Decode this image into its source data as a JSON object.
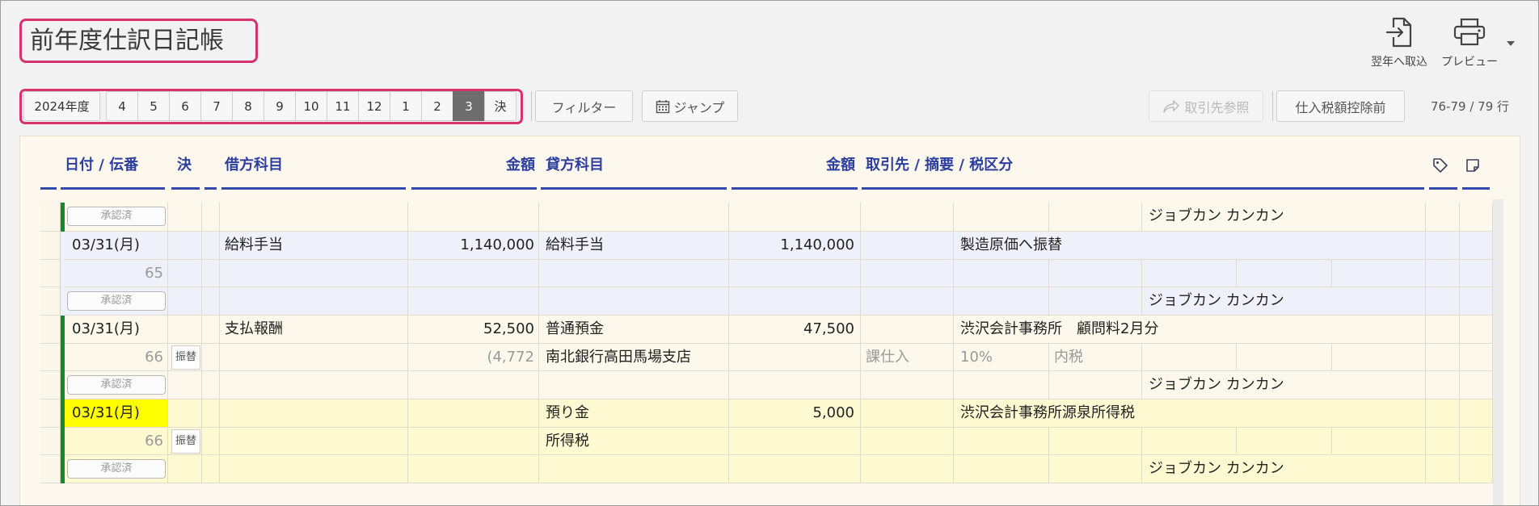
{
  "page": {
    "title": "前年度仕訳日記帳"
  },
  "actions": {
    "import_next_year": {
      "label": "翌年へ取込",
      "icon": "file-import-icon"
    },
    "preview": {
      "label": "プレビュー",
      "icon": "printer-icon",
      "menu_icon": "caret-down-icon"
    }
  },
  "period_bar": {
    "fiscal_year": "2024年度",
    "periods": [
      "4",
      "5",
      "6",
      "7",
      "8",
      "9",
      "10",
      "11",
      "12",
      "1",
      "2",
      "3",
      "決"
    ],
    "selected": "3"
  },
  "toolbar": {
    "filter": "フィルター",
    "jump": {
      "label": "ジャンプ",
      "icon": "calendar-icon"
    },
    "partner_reference": {
      "label": "取引先参照",
      "icon": "share-icon",
      "disabled": true
    },
    "tax_mode": "仕入税額控除前",
    "row_count": "76-79 / 79 行"
  },
  "table": {
    "headers": {
      "date_slip": "日付 / 伝番",
      "settlement": "決",
      "debit_account": "借方科目",
      "debit_amount": "金額",
      "credit_account": "貸方科目",
      "credit_amount": "金額",
      "partner_memo_tax": "取引先 / 摘要 / 税区分"
    },
    "header_icons": [
      "tag-icon",
      "note-icon"
    ],
    "rows": [
      {
        "status": "承認済",
        "creator": "ジョブカン カンカン"
      },
      {
        "date": "03/31(月)",
        "slip_no": "65",
        "debit_account": "給料手当",
        "debit_amount": "1,140,000",
        "credit_account": "給料手当",
        "credit_amount": "1,140,000",
        "memo": "製造原価へ振替",
        "status": "承認済",
        "creator": "ジョブカン カンカン"
      },
      {
        "date": "03/31(月)",
        "slip_no": "66",
        "entry_type": "振替",
        "debit_account": "支払報酬",
        "debit_amount": "52,500",
        "debit_tax": "(4,772",
        "credit_account": "普通預金",
        "credit_sub_account": "南北銀行高田馬場支店",
        "credit_amount": "47,500",
        "memo": "渋沢会計事務所　顧問料2月分",
        "tax_category": "課仕入",
        "tax_rate": "10%",
        "tax_method": "内税",
        "status": "承認済",
        "creator": "ジョブカン カンカン"
      },
      {
        "date": "03/31(月)",
        "slip_no": "66",
        "entry_type": "振替",
        "credit_account": "預り金",
        "credit_sub_account": "所得税",
        "credit_amount": "5,000",
        "memo": "渋沢会計事務所源泉所得税",
        "status": "承認済",
        "creator": "ジョブカン カンカン"
      }
    ]
  },
  "colors": {
    "highlight_border": "#d6336c",
    "header_text": "#2c3e9f",
    "selected_period": "#6d6d6d",
    "status_bar": "#14892f",
    "row_blue": "#eef0fa",
    "row_yellow": "#fdfad2",
    "date_highlight": "#ffff00"
  }
}
